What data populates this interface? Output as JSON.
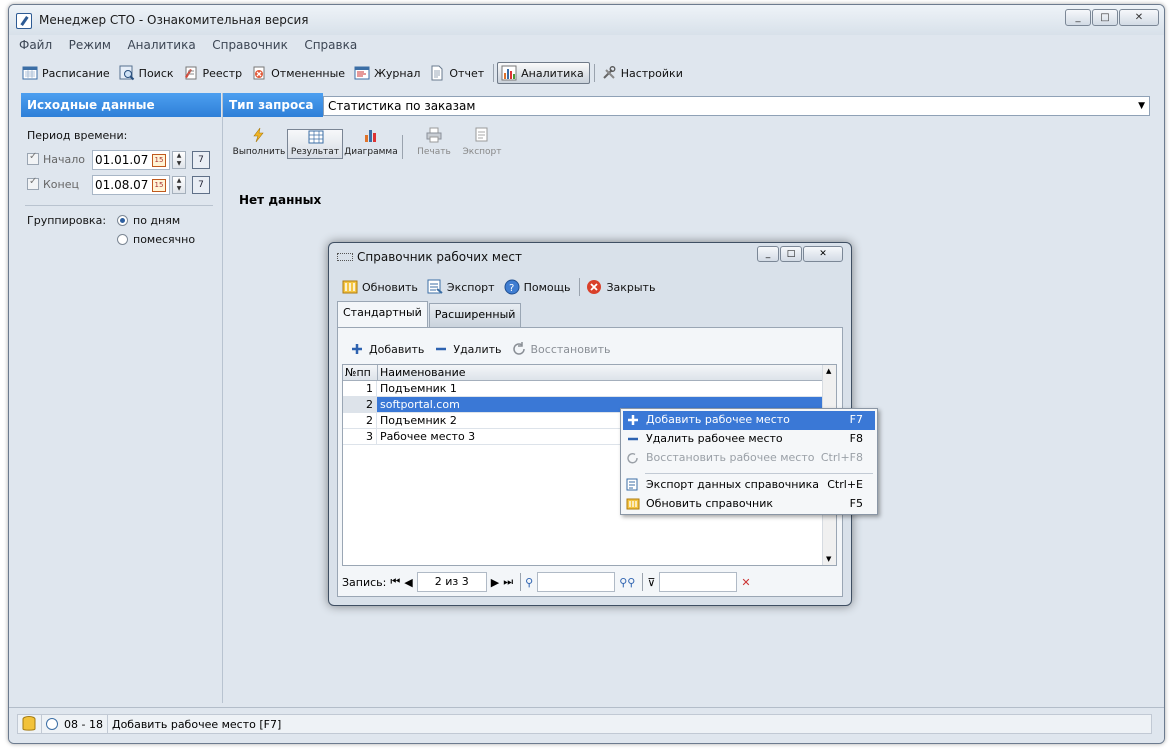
{
  "window": {
    "title": "Менеджер СТО - Ознакомительная версия",
    "controls": [
      "_",
      "□",
      "✕"
    ]
  },
  "menu": [
    "Файл",
    "Режим",
    "Аналитика",
    "Справочник",
    "Справка"
  ],
  "toolbar": {
    "items": [
      {
        "label": "Расписание",
        "icon": "calendar-icon"
      },
      {
        "label": "Поиск",
        "icon": "search-icon"
      },
      {
        "label": "Реестр",
        "icon": "registry-icon"
      },
      {
        "label": "Отмененные",
        "icon": "cancelled-icon"
      },
      {
        "label": "Журнал",
        "icon": "journal-icon"
      },
      {
        "label": "Отчет",
        "icon": "report-icon"
      },
      {
        "label": "Аналитика",
        "icon": "chart-icon",
        "active": true
      },
      {
        "label": "Настройки",
        "icon": "tools-icon"
      }
    ]
  },
  "left_panel": {
    "header": "Исходные данные",
    "period_label": "Период времени:",
    "start_label": "Начало",
    "start_value": "01.01.07",
    "end_label": "Конец",
    "end_value": "01.08.07",
    "grouping_label": "Группировка:",
    "grouping_options": [
      "по дням",
      "помесячно"
    ],
    "grouping_selected": "по дням",
    "cal_text": "15",
    "calbtn_text": "7"
  },
  "right_panel": {
    "request_label": "Тип запроса",
    "request_value": "Статистика по заказам",
    "buttons": [
      {
        "label": "Выполнить",
        "disabled": false
      },
      {
        "label": "Результат",
        "disabled": false
      },
      {
        "label": "Диаграмма",
        "disabled": false
      },
      {
        "label": "Печать",
        "disabled": true
      },
      {
        "label": "Экспорт",
        "disabled": true
      }
    ],
    "no_data": "Нет данных"
  },
  "dialog": {
    "title": "Справочник рабочих мест",
    "toolbar": [
      "Обновить",
      "Экспорт",
      "Помощь",
      "Закрыть"
    ],
    "tabs": [
      "Стандартный",
      "Расширенный"
    ],
    "active_tab": "Стандартный",
    "inner_toolbar": [
      "Добавить",
      "Удалить",
      "Восстановить"
    ],
    "columns": [
      "№пп",
      "Наименование"
    ],
    "rows": [
      {
        "num": "1",
        "name": "Подъемник 1",
        "selected": false
      },
      {
        "num": "2",
        "name": "softportal.com",
        "selected": true
      },
      {
        "num": "2",
        "name": "Подъемник 2",
        "selected": false
      },
      {
        "num": "3",
        "name": "Рабочее место 3",
        "selected": false
      }
    ],
    "nav": {
      "label": "Запись:",
      "position": "2 из 3"
    }
  },
  "context_menu": [
    {
      "label": "Добавить рабочее место",
      "shortcut": "F7",
      "highlighted": true,
      "disabled": false
    },
    {
      "label": "Удалить рабочее место",
      "shortcut": "F8",
      "highlighted": false,
      "disabled": false
    },
    {
      "label": "Восстановить рабочее место",
      "shortcut": "Ctrl+F8",
      "highlighted": false,
      "disabled": true
    },
    {
      "label": "Экспорт данных справочника",
      "shortcut": "Ctrl+E",
      "highlighted": false,
      "disabled": false
    },
    {
      "label": "Обновить справочник",
      "shortcut": "F5",
      "highlighted": false,
      "disabled": false
    }
  ],
  "statusbar": {
    "time": "08 - 18",
    "message": "Добавить рабочее место [F7]"
  },
  "colors": {
    "header_blue": "#2e7fd8",
    "selection": "#3a78d6",
    "window_bg": "#dfe6ee"
  }
}
